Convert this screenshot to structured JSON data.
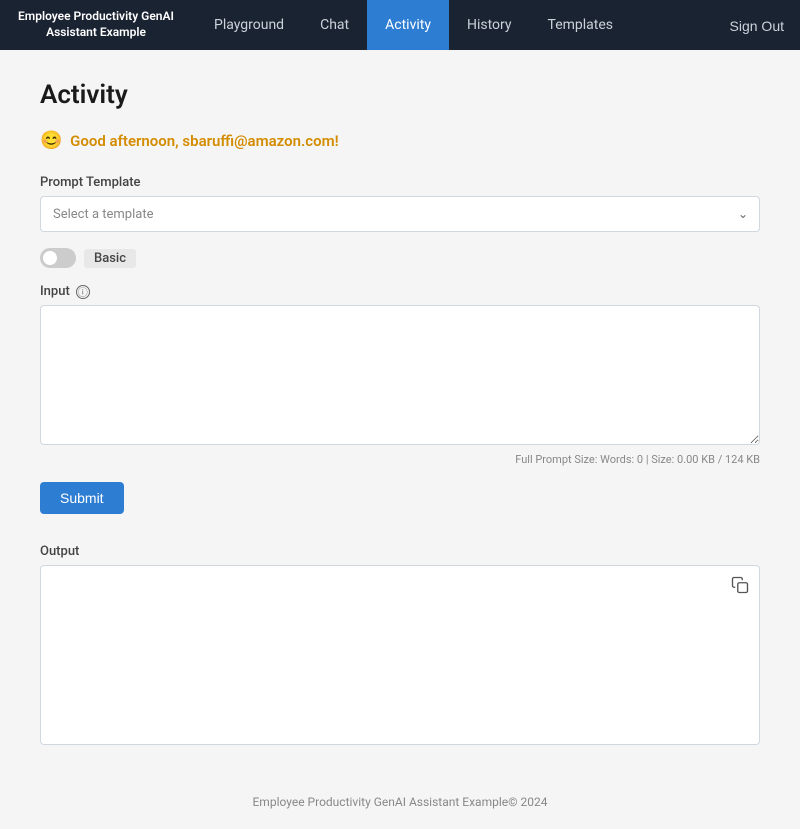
{
  "app": {
    "brand": "Employee Productivity GenAI\nAssistant Example",
    "sign_out_label": "Sign Out"
  },
  "nav": {
    "items": [
      {
        "label": "Playground",
        "id": "playground",
        "active": false
      },
      {
        "label": "Chat",
        "id": "chat",
        "active": false
      },
      {
        "label": "Activity",
        "id": "activity",
        "active": true
      },
      {
        "label": "History",
        "id": "history",
        "active": false
      },
      {
        "label": "Templates",
        "id": "templates",
        "active": false
      }
    ]
  },
  "page": {
    "title": "Activity",
    "greeting_emoji": "😊",
    "greeting_text": "Good afternoon, sbaruffi@amazon.com!"
  },
  "form": {
    "prompt_template_label": "Prompt Template",
    "prompt_template_placeholder": "Select a template",
    "toggle_label": "Basic",
    "input_label": "Input",
    "input_placeholder": "",
    "prompt_size_text": "Full Prompt Size: Words: 0 | Size: 0.00 KB / 124 KB",
    "submit_label": "Submit",
    "output_label": "Output"
  },
  "footer": {
    "text": "Employee Productivity GenAI Assistant Example© 2024"
  }
}
